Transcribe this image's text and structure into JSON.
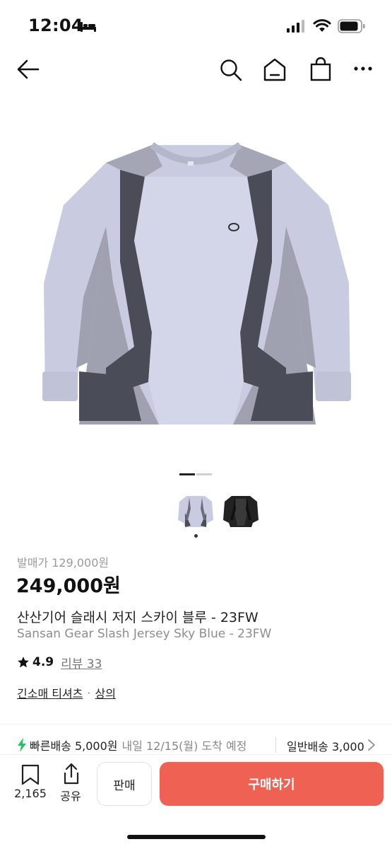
{
  "status_bar": {
    "time": "12:04",
    "icons": [
      "bed-icon",
      "signal-icon",
      "wifi-icon",
      "battery-icon"
    ]
  },
  "nav": {
    "icons": [
      "back-arrow-icon",
      "search-icon",
      "home-icon",
      "shopping-bag-icon",
      "more-icon"
    ]
  },
  "gallery": {
    "image_count": 2,
    "current_index": 1,
    "thumbnails": [
      "sky-blue-jersey",
      "black-jersey"
    ]
  },
  "product": {
    "release_price_label": "발매가 129,000원",
    "price": "249,000원",
    "name_ko": "산산기어 슬래시 저지 스카이 블루 - 23FW",
    "name_en": "Sansan Gear Slash Jersey Sky Blue - 23FW",
    "rating": "4.9",
    "review_label": "리뷰 33",
    "categories": [
      "긴소매 티셔츠",
      "상의"
    ],
    "category_separator": "·"
  },
  "shipping": {
    "fast_label": "빠른배송 5,000원",
    "fast_date": "내일 12/15(월) 도착 예정",
    "normal_label": "일반배송 3,000원"
  },
  "bottom_bar": {
    "wish_count": "2,165",
    "share_label": "공유",
    "sell_label": "판매",
    "buy_label": "구매하기"
  },
  "colors": {
    "buy_button": "#ef6253",
    "fast_shipping_icon": "#22c55e",
    "jersey_light": "#c9cbe0",
    "jersey_mid": "#9fa1b0",
    "jersey_dark": "#4a4d58"
  }
}
